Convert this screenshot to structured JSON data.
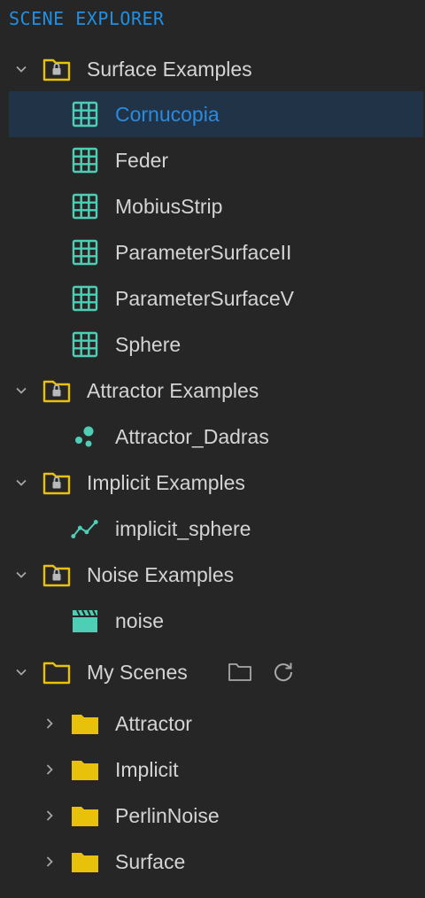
{
  "panel": {
    "title": "SCENE EXPLORER"
  },
  "colors": {
    "background": "#262626",
    "title": "#1e90e6",
    "selection_bg": "#213447",
    "selection_text": "#2a8ae0",
    "folder_yellow": "#e8c10a",
    "item_icon_teal": "#4ecfb5",
    "chevron": "#a8a8a8"
  },
  "tree": {
    "groups": [
      {
        "label": "Surface Examples",
        "icon": "locked-folder-icon",
        "expanded": true,
        "items": [
          {
            "label": "Cornucopia",
            "icon": "grid-icon",
            "selected": true
          },
          {
            "label": "Feder",
            "icon": "grid-icon"
          },
          {
            "label": "MobiusStrip",
            "icon": "grid-icon"
          },
          {
            "label": "ParameterSurfaceII",
            "icon": "grid-icon"
          },
          {
            "label": "ParameterSurfaceV",
            "icon": "grid-icon"
          },
          {
            "label": "Sphere",
            "icon": "grid-icon"
          }
        ]
      },
      {
        "label": "Attractor Examples",
        "icon": "locked-folder-icon",
        "expanded": true,
        "items": [
          {
            "label": "Attractor_Dadras",
            "icon": "scatter-dots-icon"
          }
        ]
      },
      {
        "label": "Implicit Examples",
        "icon": "locked-folder-icon",
        "expanded": true,
        "items": [
          {
            "label": "implicit_sphere",
            "icon": "line-chart-icon"
          }
        ]
      },
      {
        "label": "Noise Examples",
        "icon": "locked-folder-icon",
        "expanded": true,
        "items": [
          {
            "label": "noise",
            "icon": "clapperboard-icon"
          }
        ]
      }
    ],
    "my_scenes": {
      "label": "My Scenes",
      "icon": "folder-outline-icon",
      "expanded": true,
      "actions": [
        "new-folder-icon",
        "refresh-icon"
      ],
      "folders": [
        {
          "label": "Attractor",
          "icon": "folder-filled-icon",
          "expanded": false
        },
        {
          "label": "Implicit",
          "icon": "folder-filled-icon",
          "expanded": false
        },
        {
          "label": "PerlinNoise",
          "icon": "folder-filled-icon",
          "expanded": false
        },
        {
          "label": "Surface",
          "icon": "folder-filled-icon",
          "expanded": false
        }
      ]
    }
  }
}
